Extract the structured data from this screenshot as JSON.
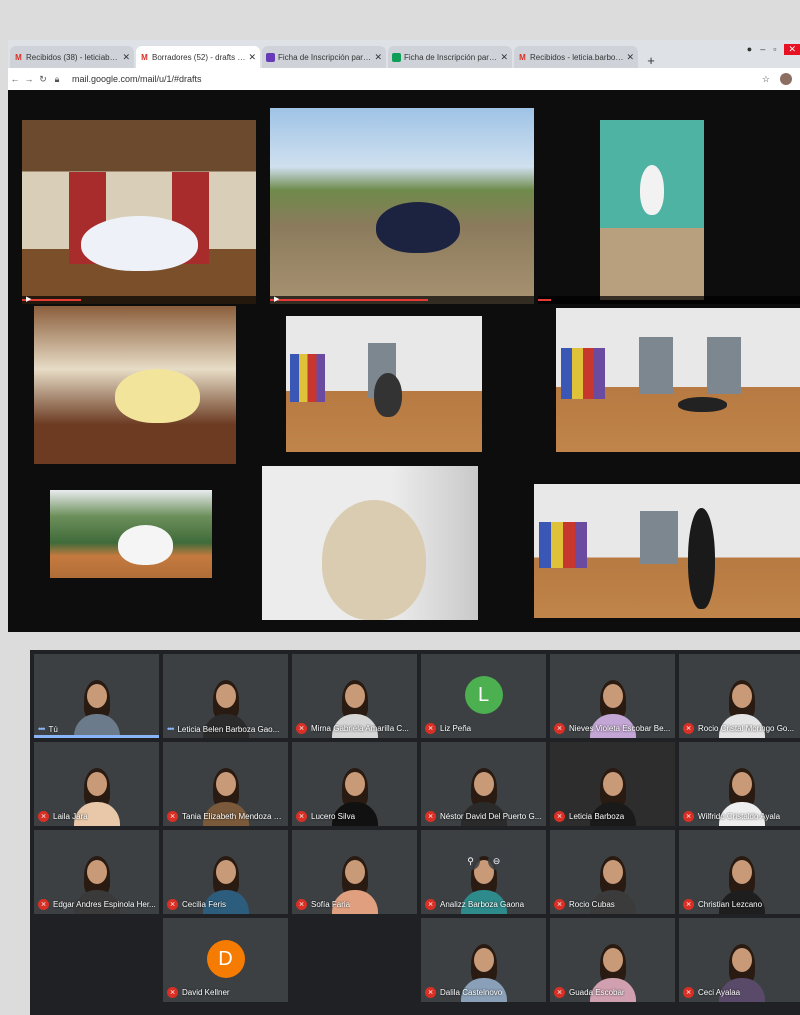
{
  "browser": {
    "tabs": [
      {
        "icon": "gmail-icon",
        "label": "Recibidos (38) - leticiabelen88@"
      },
      {
        "icon": "gmail-icon",
        "label": "Borradores (52) - drafts - leticia"
      },
      {
        "icon": "forms-icon",
        "label": "Ficha de Inscripción para Pos"
      },
      {
        "icon": "sheets-icon",
        "label": "Ficha de Inscripción para Pos"
      },
      {
        "icon": "gmail-icon",
        "label": "Recibidos - leticia.barboza@"
      }
    ],
    "new_tab": "+",
    "url": "mail.google.com/mail/u/1/#drafts"
  },
  "meet": {
    "participants": [
      {
        "name": "Tú",
        "kind": "video",
        "speaking": true,
        "shirt": "#6c7b8b"
      },
      {
        "name": "Leticia Belen Barboza Gao...",
        "kind": "video",
        "speaking": true,
        "shirt": "#2b2b2b"
      },
      {
        "name": "Mirna Gabriela Amarilla C...",
        "kind": "video",
        "shirt": "#d6d6d6"
      },
      {
        "name": "Liz Peña",
        "kind": "avatar",
        "initial": "L",
        "color": "#4caf50"
      },
      {
        "name": "Nieves Violeta Escobar Be...",
        "kind": "video",
        "shirt": "#c4a6d6"
      },
      {
        "name": "Rocio Cristal Moringo Go...",
        "kind": "video",
        "shirt": "#e4e4e4"
      },
      {
        "name": "Laila Jara",
        "kind": "video",
        "shirt": "#e8c8a8"
      },
      {
        "name": "Tania Elizabeth Mendoza R...",
        "kind": "video",
        "shirt": "#7a5a3a"
      },
      {
        "name": "Lucero Silva",
        "kind": "video",
        "shirt": "#111111"
      },
      {
        "name": "Néstor David Del Puerto G...",
        "kind": "video",
        "shirt": "#2a2a2a"
      },
      {
        "name": "Leticia Barboza",
        "kind": "photo",
        "shirt": "#1a1a1a"
      },
      {
        "name": "Wilfrido Cristaldo Ayala",
        "kind": "video",
        "shirt": "#eeeeee"
      },
      {
        "name": "Edgar Andres Espinola Her...",
        "kind": "video",
        "shirt": "#3a3a3a"
      },
      {
        "name": "Cecilia Feris",
        "kind": "video",
        "shirt": "#2c5d7c"
      },
      {
        "name": "Sofía Faria",
        "kind": "video",
        "shirt": "#e0a080"
      },
      {
        "name": "Analizz Barboza Gaona",
        "kind": "video",
        "shirt": "#2e8b8b",
        "hover": true
      },
      {
        "name": "Rocio Cubas",
        "kind": "video",
        "shirt": "#3b3b3b"
      },
      {
        "name": "Christian Lezcano",
        "kind": "video",
        "shirt": "#1e1e1e"
      },
      {
        "name": "",
        "kind": "empty"
      },
      {
        "name": "David Kellner",
        "kind": "avatar",
        "initial": "D",
        "color": "#f57c00"
      },
      {
        "name": "",
        "kind": "empty"
      },
      {
        "name": "Dalila Castelnovo",
        "kind": "video",
        "shirt": "#8aa0b8"
      },
      {
        "name": "Guada Escobar",
        "kind": "video",
        "shirt": "#d0a0b0"
      },
      {
        "name": "Ceci Ayalaa",
        "kind": "video",
        "shirt": "#5a4a6a"
      }
    ]
  }
}
